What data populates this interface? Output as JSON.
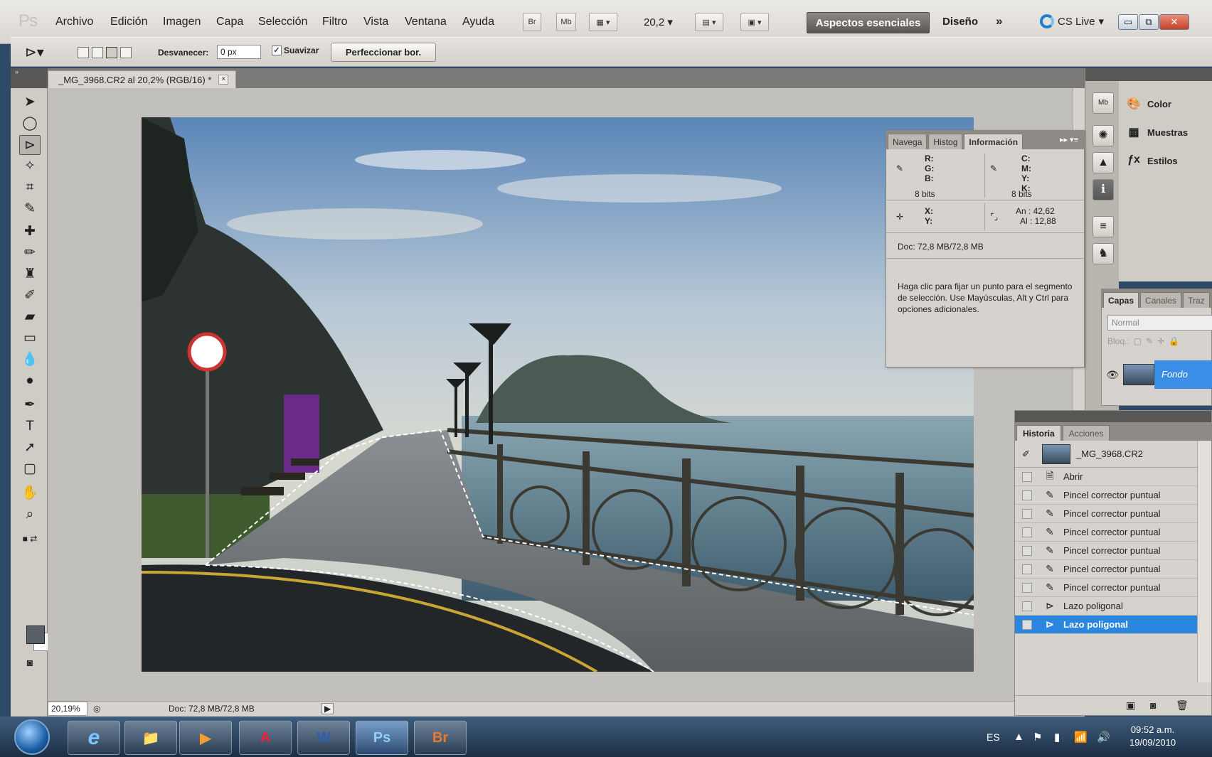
{
  "app": {
    "logo": "Ps",
    "menu": [
      "Archivo",
      "Edición",
      "Imagen",
      "Capa",
      "Selección",
      "Filtro",
      "Vista",
      "Ventana",
      "Ayuda"
    ],
    "toolbar_buttons": [
      "Br",
      "Mb"
    ],
    "zoom_select": "20,2",
    "workspaces": {
      "essentials": "Aspectos esenciales",
      "design": "Diseño",
      "more": "»"
    },
    "cs_live": "CS Live"
  },
  "options_bar": {
    "feather_label": "Desvanecer:",
    "feather_value": "0 px",
    "smooth_label": "Suavizar",
    "smooth_checked": "✓",
    "refine_button": "Perfeccionar bor."
  },
  "document": {
    "tab_title": "_MG_3968.CR2 al 20,2% (RGB/16) *",
    "close_glyph": "×"
  },
  "status_bar": {
    "zoom": "20,19%",
    "doc_size": "Doc: 72,8 MB/72,8 MB"
  },
  "side_panels": {
    "color": "Color",
    "swatches": "Muestras",
    "styles": "Estilos"
  },
  "info_panel": {
    "tabs": [
      "Navega",
      "Histog",
      "Información"
    ],
    "rgb_labels": "R:\nG:\nB:",
    "cmyk_labels": "C:\nM:\nY:\nK:",
    "bits_left": "8 bits",
    "bits_right": "8 bits",
    "xy_labels": "X:\nY:",
    "width_label": "An : 42,62",
    "height_label": "Al : 12,88",
    "doc_size": "Doc: 72,8 MB/72,8 MB",
    "hint": "Haga clic para fijar un punto para el segmento de selección. Use Mayúsculas, Alt y Ctrl para opciones adicionales."
  },
  "layers_panel": {
    "tabs": [
      "Capas",
      "Canales",
      "Traz"
    ],
    "blend_mode": "Normal",
    "lock_label": "Bloq.:",
    "layer_name": "Fondo"
  },
  "history_panel": {
    "tabs": [
      "Historia",
      "Acciones"
    ],
    "snapshot_name": "_MG_3968.CR2",
    "items": [
      "Abrir",
      "Pincel corrector puntual",
      "Pincel corrector puntual",
      "Pincel corrector puntual",
      "Pincel corrector puntual",
      "Pincel corrector puntual",
      "Pincel corrector puntual",
      "Lazo poligonal",
      "Lazo poligonal"
    ],
    "active_index": 8
  },
  "taskbar": {
    "apps": [
      "e",
      "📁",
      "▶",
      "A",
      "W",
      "Ps",
      "Br"
    ],
    "active_app": "Ps",
    "language": "ES",
    "time": "09:52 a.m.",
    "date": "19/09/2010"
  },
  "colors": {
    "accent": "#2b86e0",
    "workspace_active": "#5a5752",
    "canvas_bg": "#c2c0bd"
  }
}
